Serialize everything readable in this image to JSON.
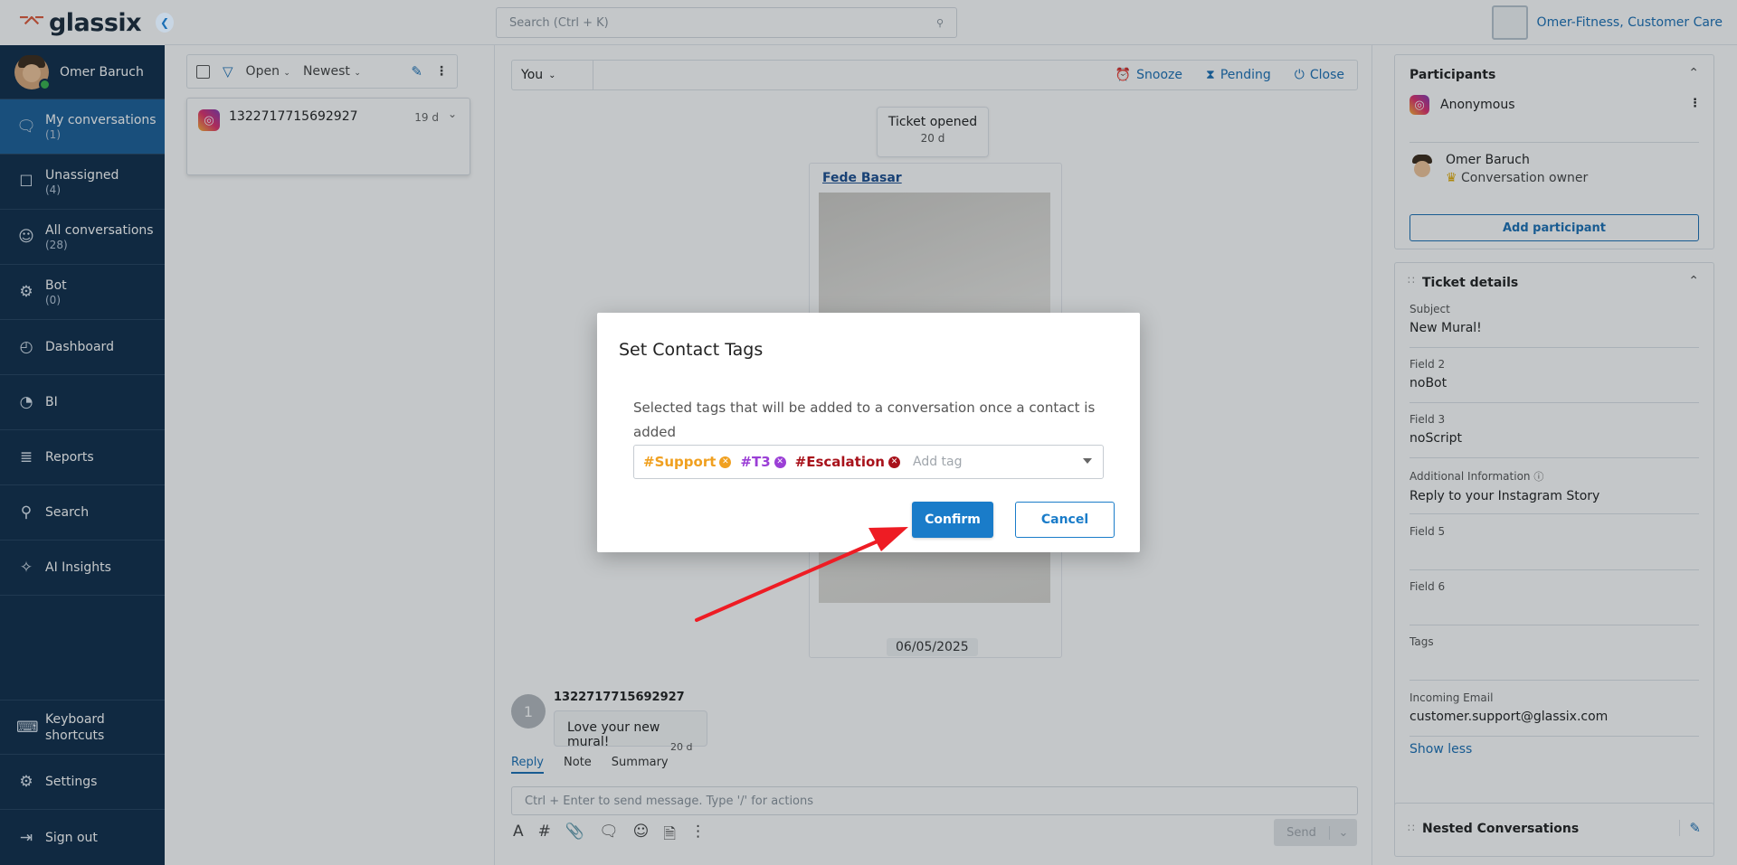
{
  "brand": {
    "name": "glassix"
  },
  "user": {
    "name": "Omer Baruch"
  },
  "nav": {
    "items": [
      {
        "label": "My conversations",
        "count": "(1)"
      },
      {
        "label": "Unassigned",
        "count": "(4)"
      },
      {
        "label": "All conversations",
        "count": "(28)"
      },
      {
        "label": "Bot",
        "count": "(0)"
      },
      {
        "label": "Dashboard"
      },
      {
        "label": "BI"
      },
      {
        "label": "Reports"
      },
      {
        "label": "Search"
      },
      {
        "label": "AI Insights"
      }
    ],
    "bottom": [
      {
        "label": "Keyboard shortcuts"
      },
      {
        "label": "Settings"
      },
      {
        "label": "Sign out"
      }
    ]
  },
  "topbar": {
    "search_placeholder": "Search (Ctrl + K)",
    "company": "Omer-Fitness, Customer Care"
  },
  "list": {
    "filter_status": "Open",
    "sort": "Newest",
    "conversation": {
      "id": "1322717715692927",
      "age": "19 d"
    }
  },
  "chat": {
    "assignee": "You",
    "actions": {
      "snooze": "Snooze",
      "pending": "Pending",
      "close": "Close"
    },
    "ticket_opened": {
      "title": "Ticket opened",
      "age": "20 d"
    },
    "story_user": "Fede Basar",
    "date_chip": "06/05/2025",
    "message": {
      "avatar": "1",
      "author": "1322717715692927",
      "text": "Love your new mural!",
      "age": "20 d"
    },
    "composer": {
      "tabs": [
        "Reply",
        "Note",
        "Summary"
      ],
      "placeholder": "Ctrl + Enter to send message. Type '/' for actions",
      "send": "Send"
    }
  },
  "participants": {
    "title": "Participants",
    "items": [
      {
        "name": "Anonymous"
      },
      {
        "name": "Omer Baruch",
        "role": "Conversation owner"
      }
    ],
    "add_label": "Add participant"
  },
  "ticket_details": {
    "title": "Ticket details",
    "fields": [
      {
        "label": "Subject",
        "value": "New Mural!"
      },
      {
        "label": "Field 2",
        "value": "noBot"
      },
      {
        "label": "Field 3",
        "value": "noScript"
      },
      {
        "label": "Additional Information",
        "value": "Reply to your Instagram Story"
      },
      {
        "label": "Field 5",
        "value": ""
      },
      {
        "label": "Field 6",
        "value": ""
      },
      {
        "label": "Tags",
        "value": ""
      },
      {
        "label": "Incoming Email",
        "value": "customer.support@glassix.com"
      }
    ],
    "show_less": "Show less"
  },
  "nested": {
    "title": "Nested Conversations"
  },
  "modal": {
    "title": "Set Contact Tags",
    "description": "Selected tags that will be added to a conversation once a contact is added",
    "tags": [
      {
        "label": "#Support",
        "color": "#f0a020"
      },
      {
        "label": "#T3",
        "color": "#9b3fd6"
      },
      {
        "label": "#Escalation",
        "color": "#a8121b"
      }
    ],
    "add_tag_placeholder": "Add tag",
    "confirm": "Confirm",
    "cancel": "Cancel"
  },
  "colors": {
    "sidebar": "#0f2d4a",
    "active_nav": "#1b5f99",
    "accent": "#1a7cc9",
    "arrow": "#ee1c24"
  }
}
